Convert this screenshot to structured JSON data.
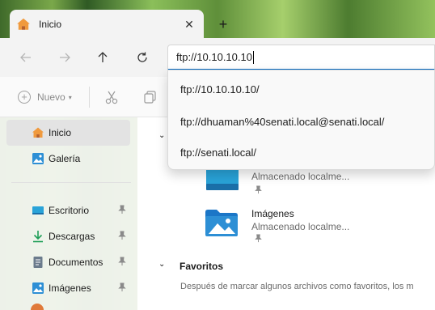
{
  "tab": {
    "title": "Inicio",
    "close_glyph": "✕",
    "new_tab_glyph": "+"
  },
  "address": {
    "value": "ftp://10.10.10.10"
  },
  "suggestions": [
    {
      "text": "ftp://10.10.10.10/"
    },
    {
      "text": "ftp://dhuaman%40senati.local@senati.local/"
    },
    {
      "text": "ftp://senati.local/"
    }
  ],
  "commandbar": {
    "new_label": "Nuevo"
  },
  "sidebar": {
    "items": [
      {
        "label": "Inicio",
        "icon": "home-icon"
      },
      {
        "label": "Galería",
        "icon": "gallery-icon"
      },
      {
        "label": "Escritorio",
        "icon": "desktop-icon"
      },
      {
        "label": "Descargas",
        "icon": "downloads-icon"
      },
      {
        "label": "Documentos",
        "icon": "documents-icon"
      },
      {
        "label": "Imágenes",
        "icon": "pictures-icon"
      }
    ]
  },
  "main": {
    "quick_access": [
      {
        "name": "",
        "location": "Almacenado localme..."
      },
      {
        "name": "Imágenes",
        "location": "Almacenado localme..."
      }
    ],
    "favorites": {
      "title": "Favoritos",
      "description": "Después de marcar algunos archivos como favoritos, los m"
    }
  },
  "colors": {
    "accent": "#0067c0",
    "folder": "#2d8fd5",
    "home": "#f09a3e"
  }
}
